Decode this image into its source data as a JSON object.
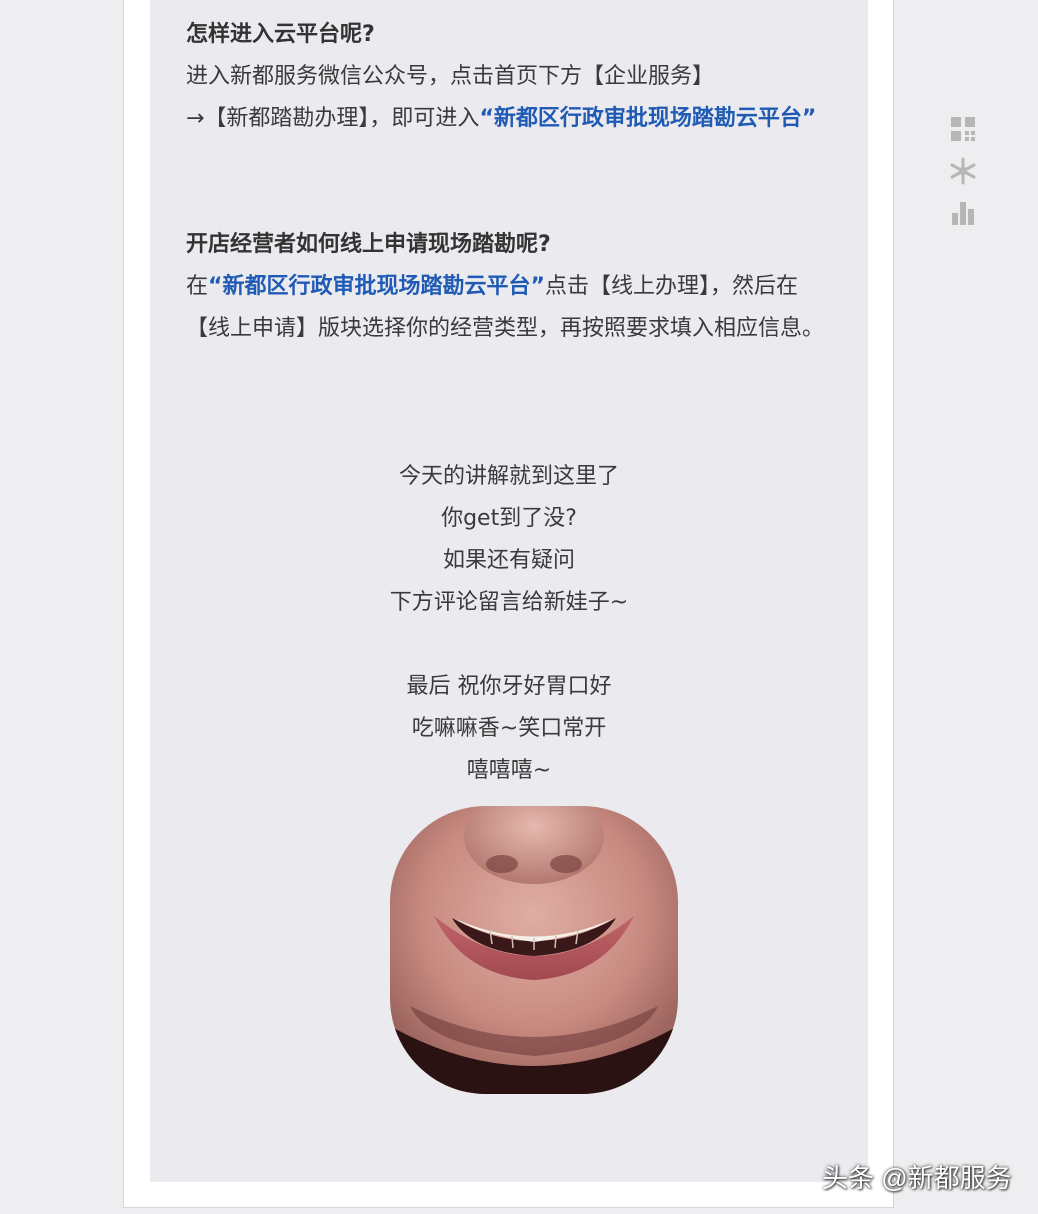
{
  "section1": {
    "heading": "怎样进入云平台呢?",
    "line1": "进入新都服务微信公众号，点击首页下方【企业服务】",
    "line2_prefix": "→【新都踏勘办理】，即可进入",
    "link": "“新都区行政审批现场踏勘云平台”"
  },
  "section2": {
    "heading": "开店经营者如何线上申请现场踏勘呢?",
    "prefix": "在",
    "link": "“新都区行政审批现场踏勘云平台”",
    "body": "点击【线上办理】，然后在【线上申请】版块选择你的经营类型，再按照要求填入相应信息。"
  },
  "closing1": {
    "lines": [
      "今天的讲解就到这里了",
      "你get到了没?",
      "如果还有疑问",
      "下方评论留言给新娃子~"
    ]
  },
  "closing2": {
    "lines": [
      "最后 祝你牙好胃口好",
      "吃嘛嘛香~笑口常开",
      "嘻嘻嘻~"
    ]
  },
  "sidebar": {
    "icons": [
      "grid-icon",
      "snowflake-icon",
      "bar-chart-icon"
    ]
  },
  "watermark": "头条 @新都服务",
  "colors": {
    "link": "#1f5bb5",
    "article_bg": "#ebeaef",
    "icon": "#b6b6b6"
  }
}
